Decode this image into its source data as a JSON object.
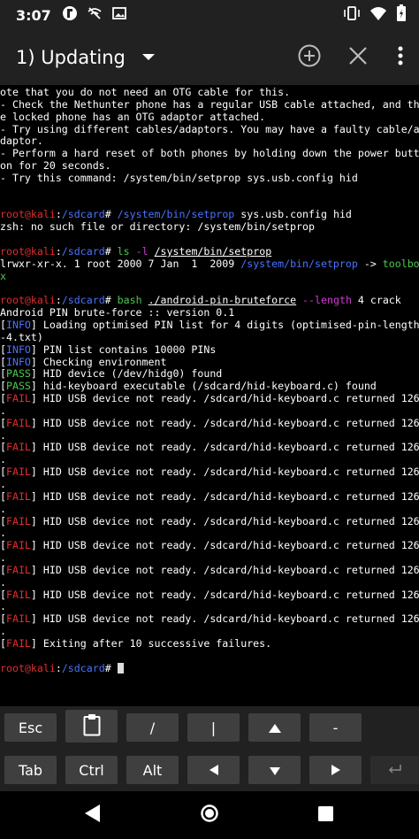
{
  "status_bar": {
    "time": "3:07"
  },
  "app_bar": {
    "title": "1) Updating"
  },
  "terminal": {
    "lines": [
      [
        {
          "t": "ote that you do not need an OTG cable for this."
        }
      ],
      [
        {
          "t": "- Check the Nethunter phone has a regular USB cable attached, and th"
        }
      ],
      [
        {
          "t": "e locked phone has an OTG adaptor attached."
        }
      ],
      [
        {
          "t": "- Try using different cables/adaptors. You may have a faulty cable/a"
        }
      ],
      [
        {
          "t": "daptor."
        }
      ],
      [
        {
          "t": "- Perform a hard reset of both phones by holding down the power butt"
        }
      ],
      [
        {
          "t": "on for 20 seconds."
        }
      ],
      [
        {
          "t": "- Try this command: /system/bin/setprop sys.usb.config hid"
        }
      ],
      [
        {
          "t": ""
        }
      ],
      [
        {
          "t": ""
        }
      ],
      [
        {
          "t": "root@kali",
          "c": "red"
        },
        {
          "t": ":",
          "c": "white"
        },
        {
          "t": "/sdcard",
          "c": "blue"
        },
        {
          "t": "# "
        },
        {
          "t": "/system/bin/setprop",
          "c": "blue"
        },
        {
          "t": " sys.usb.config hid"
        }
      ],
      [
        {
          "t": "zsh: no such file or directory: /system/bin/setprop"
        }
      ],
      [
        {
          "t": ""
        }
      ],
      [
        {
          "t": "root@kali",
          "c": "red"
        },
        {
          "t": ":",
          "c": "white"
        },
        {
          "t": "/sdcard",
          "c": "blue"
        },
        {
          "t": "# "
        },
        {
          "t": "ls",
          "c": "green"
        },
        {
          "t": " "
        },
        {
          "t": "-l",
          "c": "mag"
        },
        {
          "t": " "
        },
        {
          "t": "/system/bin/setprop",
          "c": "white",
          "u": true
        }
      ],
      [
        {
          "t": "lrwxr-xr-x. 1 root 2000 7 Jan  1  2009 "
        },
        {
          "t": "/system/bin/setprop",
          "c": "blue"
        },
        {
          "t": " -> "
        },
        {
          "t": "toolbo",
          "c": "green"
        }
      ],
      [
        {
          "t": "x",
          "c": "green"
        }
      ],
      [
        {
          "t": ""
        }
      ],
      [
        {
          "t": "root@kali",
          "c": "red"
        },
        {
          "t": ":",
          "c": "white"
        },
        {
          "t": "/sdcard",
          "c": "blue"
        },
        {
          "t": "# "
        },
        {
          "t": "bash",
          "c": "green"
        },
        {
          "t": " "
        },
        {
          "t": "./android-pin-bruteforce",
          "c": "white",
          "u": true
        },
        {
          "t": " "
        },
        {
          "t": "--length",
          "c": "mag"
        },
        {
          "t": " 4 crack"
        }
      ],
      [
        {
          "t": "Android PIN brute-force :: version 0.1"
        }
      ],
      [
        {
          "t": "["
        },
        {
          "t": "INFO",
          "c": "blue"
        },
        {
          "t": "] Loading optimised PIN list for 4 digits (optimised-pin-length"
        }
      ],
      [
        {
          "t": "-4.txt)"
        }
      ],
      [
        {
          "t": "["
        },
        {
          "t": "INFO",
          "c": "blue"
        },
        {
          "t": "] PIN list contains 10000 PINs"
        }
      ],
      [
        {
          "t": "["
        },
        {
          "t": "INFO",
          "c": "blue"
        },
        {
          "t": "] Checking environment"
        }
      ],
      [
        {
          "t": "["
        },
        {
          "t": "PASS",
          "c": "green"
        },
        {
          "t": "] HID device (/dev/hidg0) found"
        }
      ],
      [
        {
          "t": "["
        },
        {
          "t": "PASS",
          "c": "green"
        },
        {
          "t": "] hid-keyboard executable (/sdcard/hid-keyboard.c) found"
        }
      ],
      [
        {
          "t": "["
        },
        {
          "t": "FAIL",
          "c": "red"
        },
        {
          "t": "] HID USB device not ready. /sdcard/hid-keyboard.c returned 126"
        }
      ],
      [
        {
          "t": "."
        }
      ],
      [
        {
          "t": "["
        },
        {
          "t": "FAIL",
          "c": "red"
        },
        {
          "t": "] HID USB device not ready. /sdcard/hid-keyboard.c returned 126"
        }
      ],
      [
        {
          "t": "."
        }
      ],
      [
        {
          "t": "["
        },
        {
          "t": "FAIL",
          "c": "red"
        },
        {
          "t": "] HID USB device not ready. /sdcard/hid-keyboard.c returned 126"
        }
      ],
      [
        {
          "t": "."
        }
      ],
      [
        {
          "t": "["
        },
        {
          "t": "FAIL",
          "c": "red"
        },
        {
          "t": "] HID USB device not ready. /sdcard/hid-keyboard.c returned 126"
        }
      ],
      [
        {
          "t": "."
        }
      ],
      [
        {
          "t": "["
        },
        {
          "t": "FAIL",
          "c": "red"
        },
        {
          "t": "] HID USB device not ready. /sdcard/hid-keyboard.c returned 126"
        }
      ],
      [
        {
          "t": "."
        }
      ],
      [
        {
          "t": "["
        },
        {
          "t": "FAIL",
          "c": "red"
        },
        {
          "t": "] HID USB device not ready. /sdcard/hid-keyboard.c returned 126"
        }
      ],
      [
        {
          "t": "."
        }
      ],
      [
        {
          "t": "["
        },
        {
          "t": "FAIL",
          "c": "red"
        },
        {
          "t": "] HID USB device not ready. /sdcard/hid-keyboard.c returned 126"
        }
      ],
      [
        {
          "t": "."
        }
      ],
      [
        {
          "t": "["
        },
        {
          "t": "FAIL",
          "c": "red"
        },
        {
          "t": "] HID USB device not ready. /sdcard/hid-keyboard.c returned 126"
        }
      ],
      [
        {
          "t": "."
        }
      ],
      [
        {
          "t": "["
        },
        {
          "t": "FAIL",
          "c": "red"
        },
        {
          "t": "] HID USB device not ready. /sdcard/hid-keyboard.c returned 126"
        }
      ],
      [
        {
          "t": "."
        }
      ],
      [
        {
          "t": "["
        },
        {
          "t": "FAIL",
          "c": "red"
        },
        {
          "t": "] HID USB device not ready. /sdcard/hid-keyboard.c returned 126"
        }
      ],
      [
        {
          "t": "."
        }
      ],
      [
        {
          "t": "["
        },
        {
          "t": "FAIL",
          "c": "red"
        },
        {
          "t": "] Exiting after 10 successive failures."
        }
      ],
      [
        {
          "t": ""
        }
      ],
      [
        {
          "t": "root@kali",
          "c": "red"
        },
        {
          "t": ":",
          "c": "white"
        },
        {
          "t": "/sdcard",
          "c": "blue"
        },
        {
          "t": "# "
        },
        {
          "cursor": true
        }
      ]
    ]
  },
  "extra_keys": {
    "row1": [
      "Esc",
      "clipboard-icon",
      "/",
      "|",
      "up-arrow-icon",
      "-"
    ],
    "row2": [
      "Tab",
      "Ctrl",
      "Alt",
      "left-arrow-icon",
      "down-arrow-icon",
      "right-arrow-icon",
      "enter-icon"
    ]
  },
  "colors": {
    "bar_bg": "#212121",
    "terminal_bg": "#000000",
    "prompt_red": "#e02d2d",
    "path_blue": "#4a73ff",
    "command_green": "#4ec94e",
    "flag_magenta": "#d23bd2",
    "key_bg": "#3f3f3f"
  }
}
